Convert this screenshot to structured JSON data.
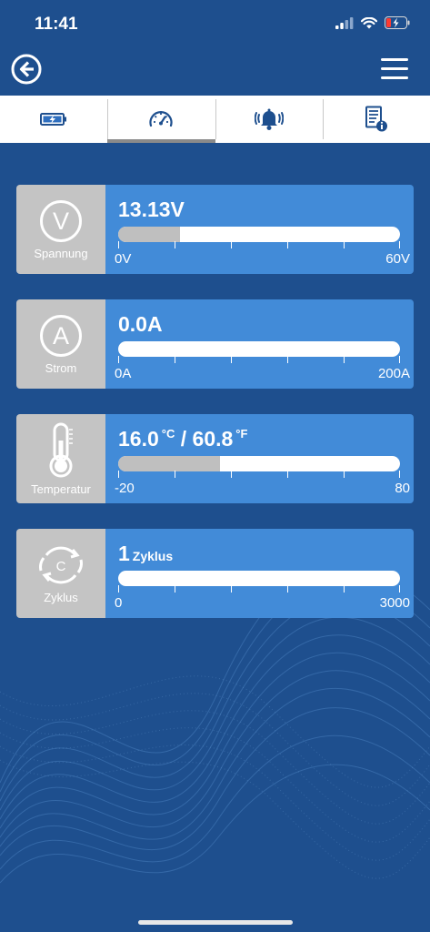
{
  "status_bar": {
    "time": "11:41",
    "icons": [
      "signal-icon",
      "wifi-icon",
      "battery-charging-icon"
    ]
  },
  "header": {
    "back_icon": "back-arrow-icon",
    "menu_icon": "hamburger-menu-icon"
  },
  "tabs": [
    {
      "icon": "battery-icon",
      "active": false
    },
    {
      "icon": "gauge-icon",
      "active": true
    },
    {
      "icon": "alarm-bell-icon",
      "active": false
    },
    {
      "icon": "info-document-icon",
      "active": false
    }
  ],
  "cards": {
    "voltage": {
      "symbol": "V",
      "label": "Spannung",
      "value": "13.13V",
      "min": "0V",
      "max": "60V",
      "fill": 0.22
    },
    "current": {
      "symbol": "A",
      "label": "Strom",
      "value": "0.0A",
      "min": "0A",
      "max": "200A",
      "fill": 0.0
    },
    "temperature": {
      "label": "Temperatur",
      "value_c": "16.0",
      "unit_c": "°C",
      "separator": "/",
      "value_f": "60.8",
      "unit_f": "°F",
      "min": "-20",
      "max": "80",
      "fill": 0.36
    },
    "cycle": {
      "symbol": "C",
      "label": "Zyklus",
      "value": "1",
      "unit": "Zyklus",
      "min": "0",
      "max": "3000",
      "fill": 0.0
    }
  },
  "colors": {
    "background": "#1e4f8e",
    "card": "#428bd8",
    "label_box": "#c4c4c4",
    "bar_fill": "#bfbfbf"
  }
}
